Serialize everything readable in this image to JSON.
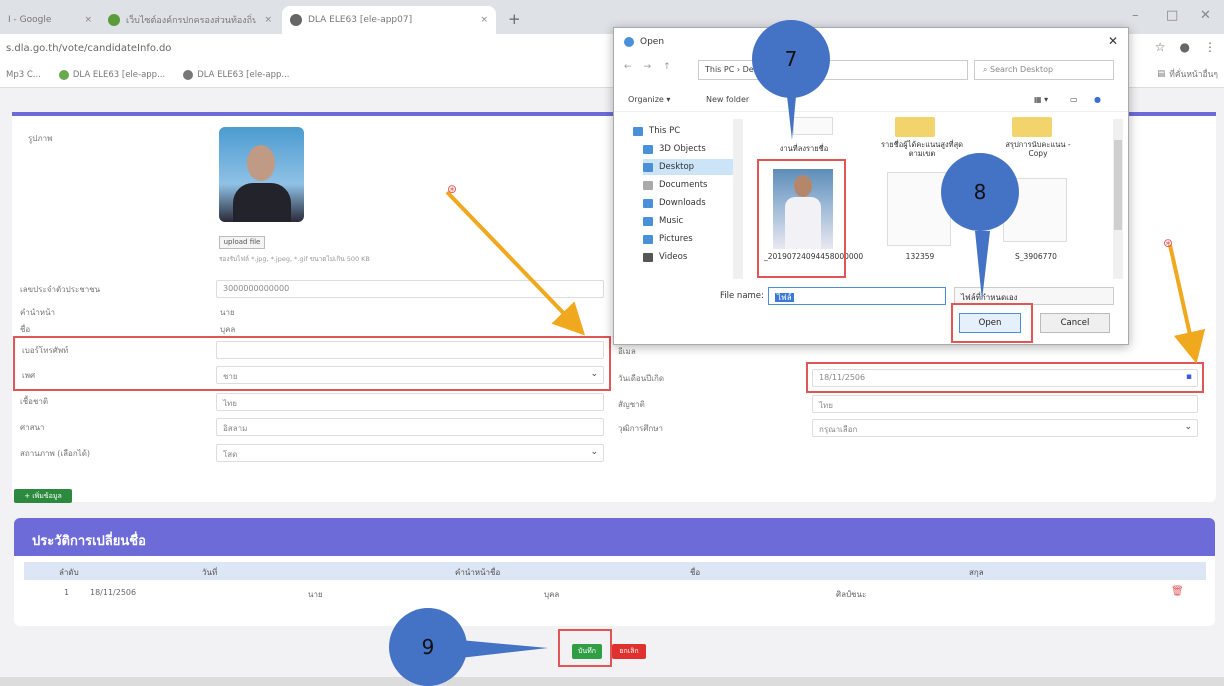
{
  "browser": {
    "tabs": [
      {
        "label": "I - Google",
        "close": "×"
      },
      {
        "label": "เว็บไซต์องค์กรปกครองส่วนท้องถิ่น",
        "close": "×"
      },
      {
        "label": "DLA ELE63 [ele-app07]",
        "close": "×"
      }
    ],
    "new_tab": "+",
    "window_controls": [
      "–",
      "□",
      "✕"
    ],
    "url": "s.dla.go.th/vote/candidateInfo.do",
    "bookmarks": [
      "Mp3 C...",
      "DLA ELE63 [ele-app...",
      "DLA ELE63 [ele-app..."
    ],
    "bookmark_right": "ที่คั่นหน้าอื่นๆ"
  },
  "form": {
    "photo_label": "รูปภาพ",
    "upload_label": "upload file",
    "upload_hint": "รองรับไฟล์ *.jpg, *.jpeg, *.gif ขนาดไม่เกิน 500 KB",
    "id_label": "เลขประจำตัวประชาชน",
    "id_value": "3000000000000",
    "prefix_label": "คำนำหน้า",
    "prefix_value": "นาย",
    "name_label": "ชื่อ",
    "name_value": "บุคล",
    "phone_label": "เบอร์โทรศัพท์",
    "phone_value": "",
    "gender_label": "เพศ",
    "gender_value": "ชาย",
    "nationality_label": "เชื้อชาติ",
    "nationality_value": "ไทย",
    "religion_label": "ศาสนา",
    "religion_value": "อิสลาม",
    "status_label": "สถานภาพ (เลือกได้)",
    "status_value": "โสด",
    "email_label": "อีเมล",
    "birthdate_label": "วันเดือนปีเกิด",
    "birthdate_value": "18/11/2506",
    "race_label": "สัญชาติ",
    "race_value": "ไทย",
    "education_label": "วุฒิการศึกษา",
    "education_value": "กรุณาเลือก",
    "add_button": "+ เพิ่มข้อมูล"
  },
  "history": {
    "title": "ประวัติการเปลี่ยนชื่อ",
    "columns": [
      "ลำดับ",
      "วันที่",
      "คำนำหน้าชื่อ",
      "ชื่อ",
      "สกุล"
    ],
    "rows": [
      {
        "no": "1",
        "date": "18/11/2506",
        "prefix": "นาย",
        "first": "บุคล",
        "last": "ศิลป์ชนะ"
      }
    ],
    "delete_icon": "🗑"
  },
  "actions": {
    "save": "บันทึก",
    "cancel": "ยกเลิก"
  },
  "dialog": {
    "title": "Open",
    "close": "✕",
    "path": "This PC  ›  Desktop",
    "search_placeholder": "Search Desktop",
    "organize": "Organize ▾",
    "new_folder": "New folder",
    "sidebar": [
      "This PC",
      "3D Objects",
      "Desktop",
      "Documents",
      "Downloads",
      "Music",
      "Pictures",
      "Videos"
    ],
    "files": [
      {
        "name": "งานที่ลงรายชื่อ"
      },
      {
        "name": "รายชื่อผู้ได้คะแนนสูงที่สุดตามเขต"
      },
      {
        "name": "สรุปการนับคะแนน - Copy"
      },
      {
        "name": "_20190724094458000000"
      },
      {
        "name": "132359"
      },
      {
        "name": "S_3906770"
      }
    ],
    "filename_label": "File name:",
    "filename_value": "ไฟล์",
    "filetype_value": "ไฟล์ที่กำหนดเอง",
    "open_button": "Open",
    "cancel_button": "Cancel"
  },
  "callouts": {
    "step7": "7",
    "step8": "8",
    "step9": "9"
  },
  "colors": {
    "accent": "#6d6bd8",
    "highlight": "#e05555",
    "callout": "#4472c4",
    "arrow": "#f0a81e",
    "save": "#2f9e44",
    "cancel": "#e03131"
  }
}
